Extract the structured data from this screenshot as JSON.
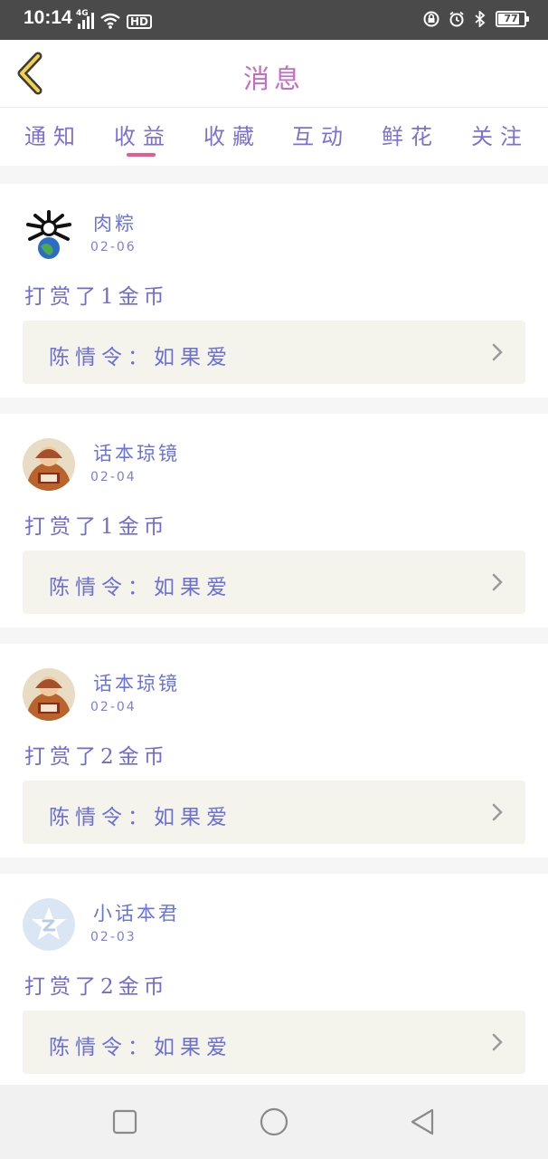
{
  "status_bar": {
    "time": "10:14",
    "network": "4G",
    "hd": "HD",
    "battery": "77"
  },
  "header": {
    "title": "消息"
  },
  "tabs": [
    {
      "label": "通知",
      "active": false
    },
    {
      "label": "收益",
      "active": true
    },
    {
      "label": "收藏",
      "active": false
    },
    {
      "label": "互动",
      "active": false
    },
    {
      "label": "鲜花",
      "active": false
    },
    {
      "label": "关注",
      "active": false
    }
  ],
  "messages": [
    {
      "user": "肉粽",
      "date": "02-06",
      "action": "打赏了1金币",
      "work": "陈情令：如果爱",
      "avatar": "meme-avatar-icon"
    },
    {
      "user": "话本琼镜",
      "date": "02-04",
      "action": "打赏了1金币",
      "work": "陈情令：如果爱",
      "avatar": "monk-avatar-icon"
    },
    {
      "user": "话本琼镜",
      "date": "02-04",
      "action": "打赏了2金币",
      "work": "陈情令：如果爱",
      "avatar": "monk-avatar-icon"
    },
    {
      "user": "小话本君",
      "date": "02-03",
      "action": "打赏了2金币",
      "work": "陈情令：如果爱",
      "avatar": "default-star-avatar-icon"
    }
  ],
  "colors": {
    "accent": "#ea5a8f",
    "tab_text": "#7d6fd6",
    "title": "#c86ac9",
    "card_box": "#f4f3ec"
  }
}
